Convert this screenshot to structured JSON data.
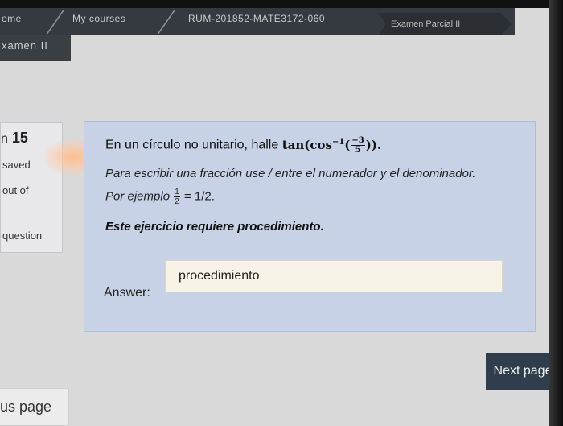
{
  "breadcrumb": {
    "items": [
      "ome",
      "My courses",
      "RUM-201852-MATE3172-060"
    ],
    "current": "Examen Parcial II"
  },
  "page": {
    "heading": "xamen II"
  },
  "question_info": {
    "number_prefix": "n",
    "number": "15",
    "status": "saved",
    "marks": "out of",
    "flag": "question"
  },
  "question": {
    "prompt": "En un círculo no unitario, halle",
    "math_func": "tan(cos",
    "math_exp": "−1",
    "math_open": "(",
    "frac_num": "−3",
    "frac_den": "5",
    "math_close": ")).",
    "instruction": "Para escribir una fracción use / entre el numerador y el denominador.",
    "example_label": "Por ejemplo",
    "example_num": "1",
    "example_den": "2",
    "example_result": "= 1/2.",
    "note": "Este ejercicio requiere procedimiento."
  },
  "answer": {
    "label": "Answer:",
    "value": "procedimiento"
  },
  "navigation": {
    "next_label": "Next page",
    "prev_label": "us page"
  },
  "colors": {
    "question_bg": "#c7d2e6",
    "breadcrumb_bg": "#343a40",
    "button_bg": "#2f3d4d",
    "answer_bg": "#f7f3e6"
  }
}
